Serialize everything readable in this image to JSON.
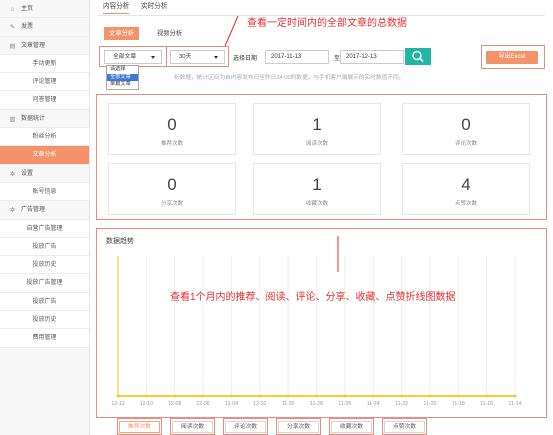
{
  "sidebar": {
    "items": [
      {
        "label": "主页",
        "type": "top",
        "icon": "home-icon",
        "glyph": "⌂"
      },
      {
        "label": "发票",
        "type": "top",
        "icon": "pencil-icon",
        "glyph": "✎"
      },
      {
        "label": "文章管理",
        "type": "top",
        "icon": "document-icon",
        "glyph": "▤"
      },
      {
        "label": "手动更新",
        "type": "sub"
      },
      {
        "label": "评论管理",
        "type": "sub"
      },
      {
        "label": "问答管理",
        "type": "sub"
      },
      {
        "label": "数据统计",
        "type": "top",
        "icon": "bar-chart-icon",
        "glyph": "▥"
      },
      {
        "label": "粉丝分析",
        "type": "sub"
      },
      {
        "label": "文章分析",
        "type": "sub",
        "active": true
      },
      {
        "label": "设置",
        "type": "top",
        "icon": "gear-icon",
        "glyph": "✲"
      },
      {
        "label": "账号信息",
        "type": "sub"
      },
      {
        "label": "广告管理",
        "type": "top",
        "icon": "gear-icon",
        "glyph": "✲"
      },
      {
        "label": "自营广告管理",
        "type": "sub"
      },
      {
        "label": "投放广告",
        "type": "sub"
      },
      {
        "label": "投放历史",
        "type": "sub"
      },
      {
        "label": "投放广告管理",
        "type": "sub"
      },
      {
        "label": "投放广告",
        "type": "sub"
      },
      {
        "label": "投放历史",
        "type": "sub"
      },
      {
        "label": "费用管理",
        "type": "sub"
      }
    ]
  },
  "top_tabs": [
    {
      "label": "内容分析",
      "active": true
    },
    {
      "label": "实时分析",
      "active": false
    }
  ],
  "sub_tabs": {
    "active": "文章分析",
    "inactive": "视频分析"
  },
  "annotations": {
    "top": "查看一定时间内的全部文章的总数据",
    "chart": "查看1个月内的推荐、阅读、评论、分享、收藏、点赞折线图数据"
  },
  "filters": {
    "article_select": "全部文章",
    "article_options": [
      "请选择",
      "全部文章",
      "单篇文章"
    ],
    "article_selected_index": 1,
    "period_select": "30天",
    "date_label": "选择日期",
    "start_date": "2017-11-13",
    "to_label": "至",
    "end_date": "2017-12-13"
  },
  "export_label": "导出Excel",
  "note": "析数据，统计区间为自内容发布日至昨日24:00的数据，与手机客户端展示的实时数值不同。",
  "stats": [
    {
      "value": "0",
      "label": "推荐次数"
    },
    {
      "value": "1",
      "label": "阅读次数"
    },
    {
      "value": "0",
      "label": "评论次数"
    },
    {
      "value": "0",
      "label": "分享次数"
    },
    {
      "value": "1",
      "label": "收藏次数"
    },
    {
      "value": "4",
      "label": "点赞次数"
    }
  ],
  "trend_title": "数据趋势",
  "chart_data": {
    "type": "line",
    "x": [
      "12-12",
      "12-10",
      "12-08",
      "12-06",
      "12-04",
      "12-02",
      "11-30",
      "11-28",
      "11-26",
      "11-24",
      "11-22",
      "11-20",
      "11-18",
      "11-16",
      "11-14"
    ],
    "series": [
      {
        "name": "推荐次数",
        "values": [
          0,
          0,
          0,
          0,
          0,
          0,
          0,
          0,
          0,
          0,
          0,
          0,
          0,
          0,
          0
        ]
      },
      {
        "name": "阅读次数",
        "values": [
          0,
          0,
          0,
          0,
          0,
          0,
          0,
          0,
          0,
          0,
          0,
          0,
          0,
          0,
          0
        ]
      },
      {
        "name": "评论次数",
        "values": [
          0,
          0,
          0,
          0,
          0,
          0,
          0,
          0,
          0,
          0,
          0,
          0,
          0,
          0,
          0
        ]
      },
      {
        "name": "分享次数",
        "values": [
          0,
          0,
          0,
          0,
          0,
          0,
          0,
          0,
          0,
          0,
          0,
          0,
          0,
          0,
          0
        ]
      },
      {
        "name": "收藏次数",
        "values": [
          0,
          0,
          0,
          0,
          0,
          0,
          0,
          0,
          0,
          0,
          0,
          0,
          0,
          0,
          0
        ]
      },
      {
        "name": "点赞次数",
        "values": [
          0,
          0,
          0,
          0,
          0,
          0,
          0,
          0,
          0,
          0,
          0,
          0,
          0,
          0,
          0
        ]
      }
    ],
    "line_color": "#f5c518",
    "active_series": "推荐次数",
    "grid": "vertical"
  },
  "colors": {
    "accent": "#f4936a",
    "search": "#21b6a4",
    "annotation": "#e62d2d",
    "line": "#f5c518"
  }
}
